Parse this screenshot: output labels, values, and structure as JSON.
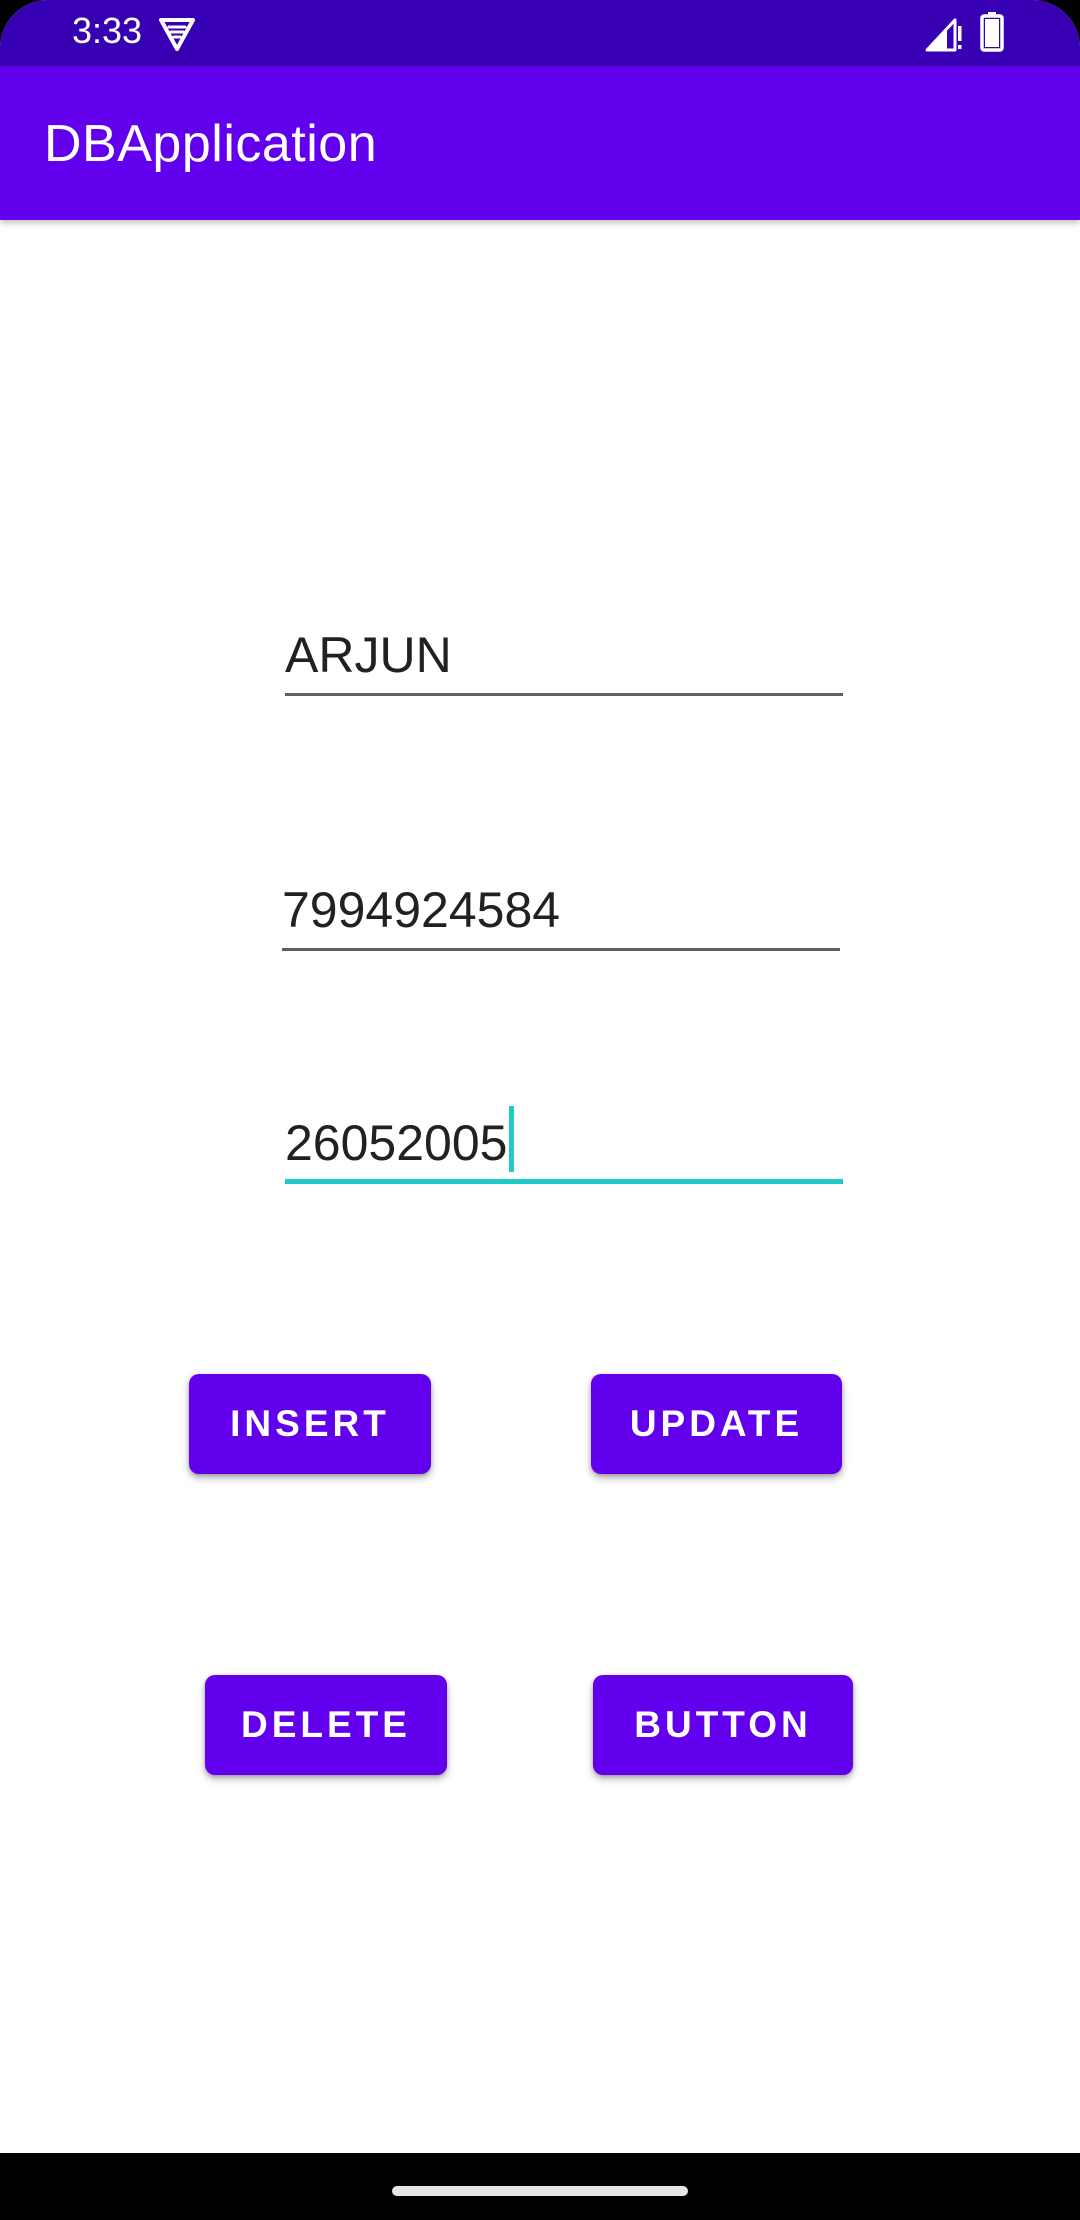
{
  "status_bar": {
    "time": "3:33",
    "icons": [
      "vpn-icon",
      "signal-icon",
      "battery-icon"
    ]
  },
  "app_bar": {
    "title": "DBApplication",
    "color": "#6200ee"
  },
  "form": {
    "name_value": "ARJUN",
    "phone_value": "7994924584",
    "dob_value": "26052005",
    "focused_field": "dob",
    "focus_color": "#1ecbc6"
  },
  "buttons": {
    "insert_label": "INSERT",
    "update_label": "UPDATE",
    "delete_label": "DELETE",
    "button_label": "BUTTON"
  },
  "colors": {
    "status_bar": "#3700b3",
    "primary": "#6200ee",
    "accent": "#1ecbc6"
  }
}
